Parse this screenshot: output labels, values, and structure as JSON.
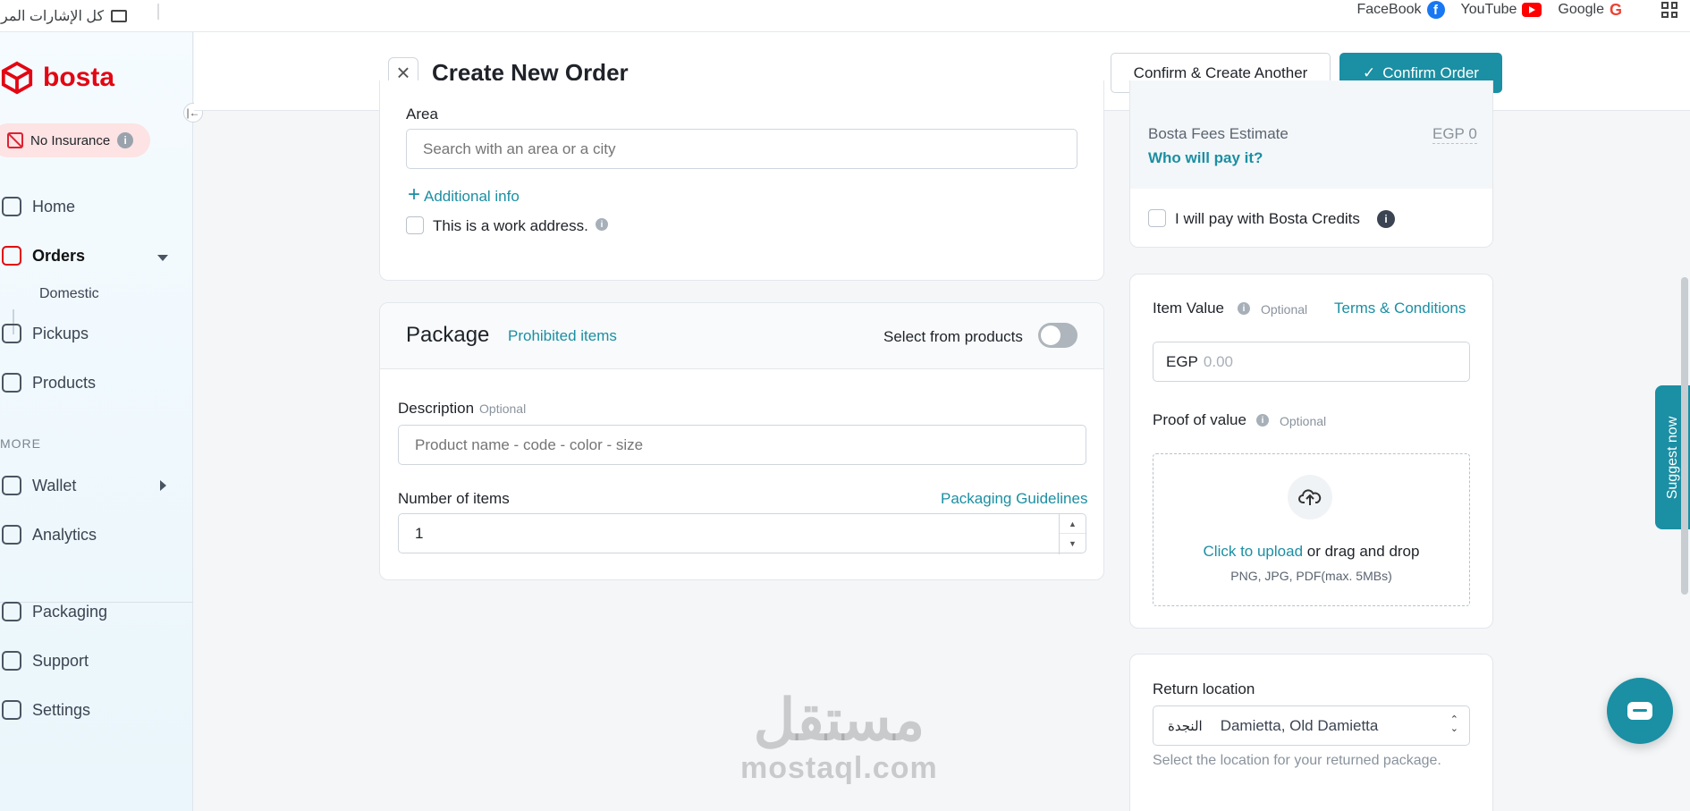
{
  "bookmarks": {
    "folder_label": "كل الإشارات المرجعية",
    "links": [
      {
        "label": "FaceBook",
        "icon": "facebook-icon"
      },
      {
        "label": "YouTube",
        "icon": "youtube-icon"
      },
      {
        "label": "Google",
        "icon": "google-icon"
      }
    ]
  },
  "sidebar": {
    "logo_text": "bosta",
    "insurance_label": "No Insurance",
    "nav": {
      "home": "Home",
      "orders": "Orders",
      "domestic": "Domestic",
      "pickups": "Pickups",
      "products": "Products",
      "more_label": "MORE",
      "wallet": "Wallet",
      "analytics": "Analytics",
      "packaging": "Packaging",
      "support": "Support",
      "settings": "Settings"
    }
  },
  "header": {
    "title": "Create New Order",
    "confirm_another": "Confirm & Create Another",
    "confirm_order": "Confirm Order"
  },
  "address": {
    "area_label": "Area",
    "area_placeholder": "Search with an area or a city",
    "additional_info": "Additional info",
    "work_address": "This is a work address."
  },
  "package": {
    "title": "Package",
    "prohibited": "Prohibited items",
    "select_products": "Select from products",
    "select_products_on": false,
    "description_label": "Description",
    "optional": "Optional",
    "description_placeholder": "Product name - code - color - size",
    "items_label": "Number of items",
    "packaging_guidelines": "Packaging Guidelines",
    "items_value": "1"
  },
  "fees": {
    "estimate_label": "Bosta Fees Estimate",
    "estimate_value": "EGP 0",
    "who_pays": "Who will pay it?",
    "credits_label": "I will pay with Bosta Credits"
  },
  "item_value": {
    "label": "Item Value",
    "optional": "Optional",
    "terms": "Terms & Conditions",
    "currency": "EGP",
    "placeholder": "0.00",
    "proof_label": "Proof of value",
    "proof_optional": "Optional",
    "upload_link": "Click to upload",
    "upload_rest": "or drag and drop",
    "upload_hint": "PNG, JPG, PDF(max. 5MBs)"
  },
  "return": {
    "label": "Return location",
    "tag": "النجدة",
    "value": "Damietta, Old Damietta",
    "hint": "Select the location for your returned package."
  },
  "suggest_label": "Suggest now",
  "watermark": {
    "ar": "مستقل",
    "en": "mostaql.com"
  },
  "colors": {
    "accent": "#1b8fa3",
    "brand": "#e30613"
  }
}
